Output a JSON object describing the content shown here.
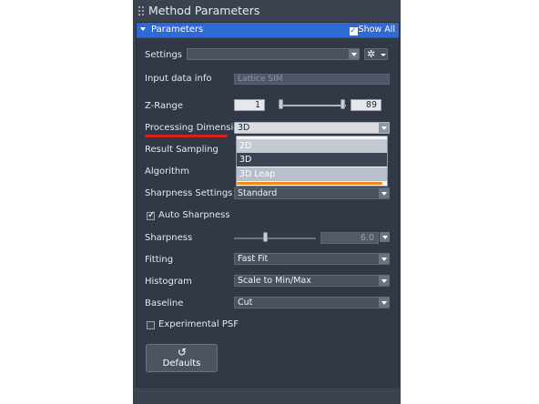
{
  "window": {
    "title": "Method Parameters"
  },
  "section": {
    "title": "Parameters",
    "show_all_label": "Show All",
    "show_all_checked": true
  },
  "settings": {
    "label": "Settings",
    "value": "",
    "gear_icon": "gear-icon"
  },
  "input_data_info": {
    "label": "Input data info",
    "value": "Lattice SIM"
  },
  "z_range": {
    "label": "Z-Range",
    "min": "1",
    "max": "89"
  },
  "processing_dimension": {
    "label": "Processing Dimension",
    "value": "3D",
    "options": [
      "2D",
      "3D",
      "3D Leap"
    ],
    "highlighted_option": "3D"
  },
  "result_sampling": {
    "label": "Result Sampling"
  },
  "algorithm": {
    "label": "Algorithm"
  },
  "sharpness_settings": {
    "label": "Sharpness Settings",
    "value": "Standard"
  },
  "auto_sharpness": {
    "label": "Auto Sharpness",
    "checked": true
  },
  "sharpness": {
    "label": "Sharpness",
    "value": "6.0",
    "level": 0.4
  },
  "fitting": {
    "label": "Fitting",
    "value": "Fast Fit"
  },
  "histogram": {
    "label": "Histogram",
    "value": "Scale to Min/Max"
  },
  "baseline": {
    "label": "Baseline",
    "value": "Cut"
  },
  "experimental_psf": {
    "label": "Experimental PSF",
    "checked": false
  },
  "defaults_button": {
    "label": "Defaults",
    "icon": "reset-icon"
  },
  "annotations": {
    "red_underline_color": "#d8221f",
    "orange_underline_color": "#f08a1a"
  },
  "colors": {
    "accent": "#2f69d6",
    "panel_bg": "#313846",
    "outer_bg": "#3c4350"
  }
}
